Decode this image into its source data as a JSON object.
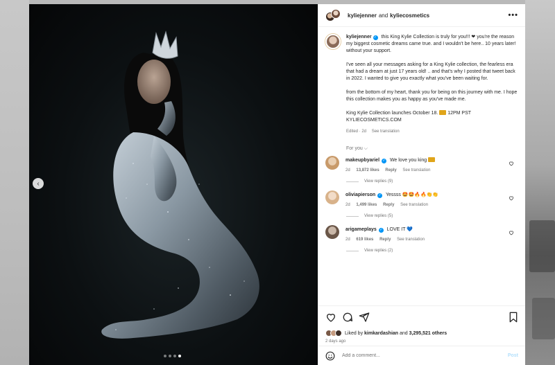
{
  "header": {
    "user1": "kyliejenner",
    "and": "and",
    "user2": "kyliecosmetics"
  },
  "caption": {
    "username": "kyliejenner",
    "p1": "this King Kylie Collection is truly for you!!! ❤ you're the reason my biggest cosmetic dreams came true. and I wouldn't be here.. 10 years later! without your support.",
    "p2": "I've seen all your messages asking for a King Kylie collection, the fearless era that had a dream at just 17 years old! .. and that's why I posted that tweet back in 2022. I wanted to give you exactly what you've been waiting for.",
    "p3": "from the bottom of my heart, thank you for being on this journey with me. I hope this collection makes you as happy as you've made me.",
    "p4a": "King Kylie Collection launches October 18.",
    "p4b": "12PM PST",
    "p4c": "KYLIECOSMETICS.COM",
    "edited": "Edited · 2d",
    "see_translation": "See translation"
  },
  "for_you": "For you ⌵",
  "comments": [
    {
      "username": "makeupbyariel",
      "text": "We love you king",
      "time": "2d",
      "likes": "13,872 likes",
      "reply": "Reply",
      "translation": "See translation",
      "view_replies": "View replies (9)",
      "avatar_color": "#c89a6a"
    },
    {
      "username": "oliviapierson",
      "text": "Yessss 🤩🤩🔥🔥👏👏",
      "time": "2d",
      "likes": "1,499 likes",
      "reply": "Reply",
      "translation": "See translation",
      "view_replies": "View replies (5)",
      "avatar_color": "#d8b28a"
    },
    {
      "username": "arigameplays",
      "text": "LOVE IT 💙",
      "time": "2d",
      "likes": "619 likes",
      "reply": "Reply",
      "translation": "See translation",
      "view_replies": "View replies (2)",
      "avatar_color": "#6a5648"
    }
  ],
  "likes": {
    "prefix": "Liked by",
    "user": "kimkardashian",
    "and": "and",
    "count": "3,295,521 others",
    "ago": "2 days ago"
  },
  "add_comment": {
    "placeholder": "Add a comment...",
    "post": "Post"
  },
  "colors": {
    "verified": "#0095f6",
    "post_button": "#b2dffc",
    "secondary_text": "#737373"
  },
  "icons": [
    "more-icon",
    "prev-arrow-icon",
    "heart-icon",
    "comment-icon",
    "share-icon",
    "bookmark-icon",
    "smile-icon",
    "verified-icon",
    "crown-emoji-icon"
  ]
}
